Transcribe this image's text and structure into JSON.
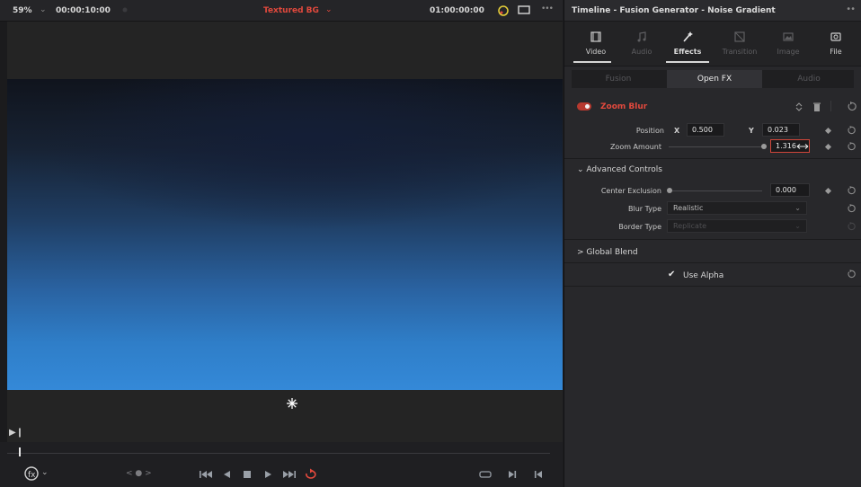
{
  "viewer": {
    "zoom": "59%",
    "timecode_left": "00:00:10:00",
    "clip_name": "Textured BG",
    "timecode_right": "01:00:00:00",
    "more": "•••"
  },
  "transport": {
    "nav": "< ● >"
  },
  "inspector": {
    "title": "Timeline - Fusion Generator - Noise Gradient",
    "tabs": [
      {
        "label": "Video",
        "icon": "film-icon"
      },
      {
        "label": "Audio",
        "icon": "music-note-icon"
      },
      {
        "label": "Effects",
        "icon": "magic-wand-icon"
      },
      {
        "label": "Transition",
        "icon": "transition-icon"
      },
      {
        "label": "Image",
        "icon": "image-icon"
      },
      {
        "label": "File",
        "icon": "file-icon"
      }
    ],
    "subtabs": [
      "Fusion",
      "Open FX",
      "Audio"
    ],
    "effect": {
      "name": "Zoom Blur",
      "enabled": true,
      "position_label": "Position",
      "x_label": "X",
      "x_value": "0.500",
      "y_label": "Y",
      "y_value": "0.023",
      "zoom_label": "Zoom Amount",
      "zoom_value": "1.316",
      "advanced_label": "Advanced Controls",
      "center_exclusion_label": "Center Exclusion",
      "center_exclusion_value": "0.000",
      "blur_type_label": "Blur Type",
      "blur_type_value": "Realistic",
      "border_type_label": "Border Type",
      "border_type_value": "Replicate",
      "global_blend_label": "Global Blend",
      "use_alpha_label": "Use Alpha",
      "use_alpha_checked": true
    }
  },
  "colors": {
    "accent_red": "#e2493d",
    "panel": "#28282b",
    "viewer_sky": "#3489d8"
  }
}
